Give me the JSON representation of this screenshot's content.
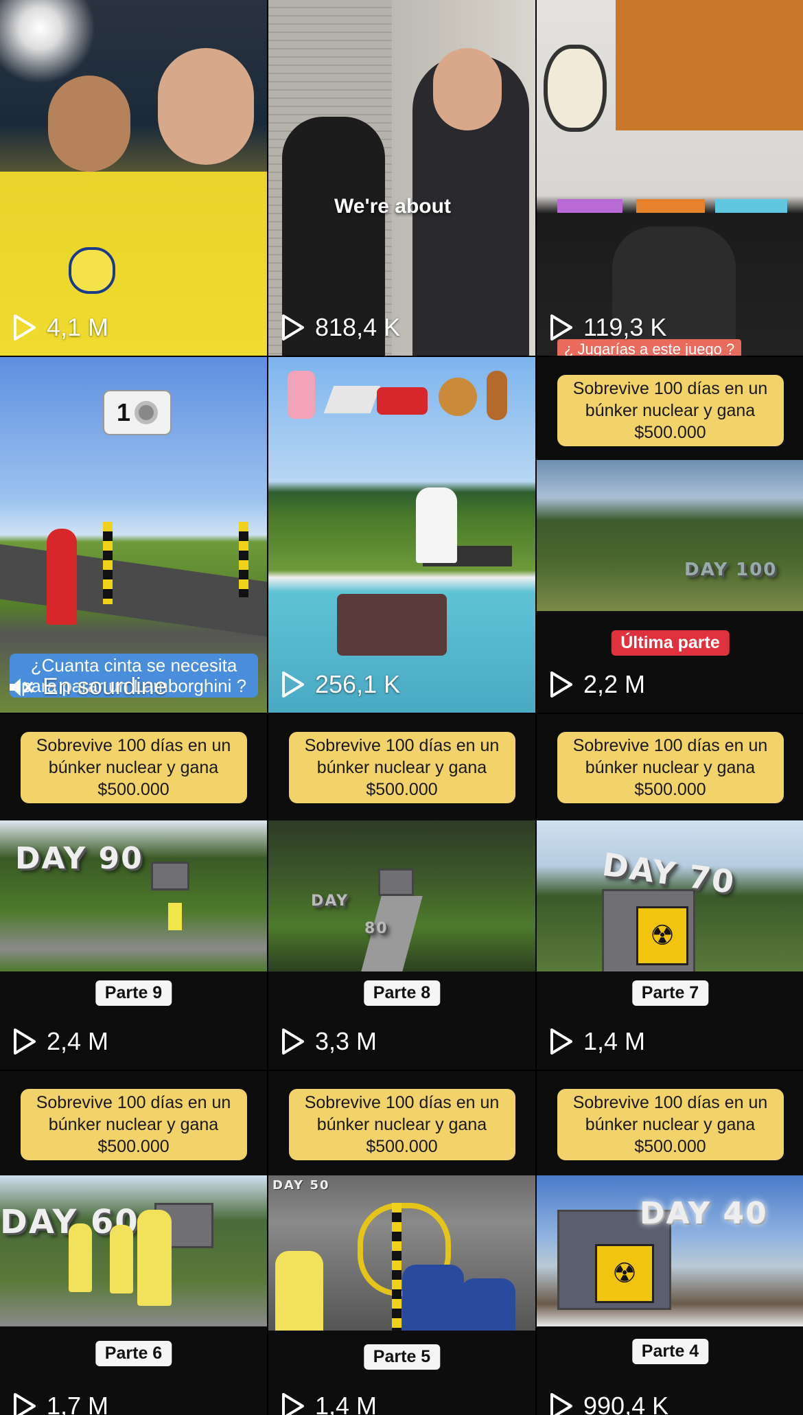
{
  "grid": {
    "tiles": [
      {
        "views": "4,1 M"
      },
      {
        "views": "818,4 K",
        "overlay": "We're about"
      },
      {
        "views": "119,3 K",
        "caption": "¿ Jugarías a este juego ?"
      },
      {
        "badge": "1",
        "caption": "¿Cuanta cinta se necesita para parar un Lamborghini ?",
        "muted": "En sourdine"
      },
      {
        "views": "256,1 K"
      },
      {
        "views": "2,2 M",
        "promo": "Sobrevive 100 días en un búnker nuclear y gana $500.000",
        "day": "DAY 100",
        "part": "Última parte"
      },
      {
        "views": "2,4 M",
        "promo": "Sobrevive 100 días en un búnker nuclear y gana $500.000",
        "day": "DAY 90",
        "part": "Parte 9"
      },
      {
        "views": "3,3 M",
        "promo": "Sobrevive 100 días en un búnker nuclear y gana $500.000",
        "day": "DAY",
        "day2": "80",
        "part": "Parte 8"
      },
      {
        "views": "1,4 M",
        "promo": "Sobrevive 100 días en un búnker nuclear y gana $500.000",
        "day": "DAY 70",
        "part": "Parte 7"
      },
      {
        "views": "1,7 M",
        "promo": "Sobrevive 100 días en un búnker nuclear y gana $500.000",
        "day": "DAY 60",
        "part": "Parte 6"
      },
      {
        "views": "1,4 M",
        "promo": "Sobrevive 100 días en un búnker nuclear y gana $500.000",
        "day": "DAY 50",
        "part": "Parte 5"
      },
      {
        "views": "990,4 K",
        "promo": "Sobrevive 100 días en un búnker nuclear y gana $500.000",
        "day": "DAY 40",
        "part": "Parte 4"
      }
    ]
  },
  "icons": {
    "play": "play-outline-icon",
    "mute": "speaker-muted-icon"
  },
  "colors": {
    "promo_bg": "#f2d36b",
    "last_part_bg": "#e0313e",
    "background": "#000000"
  }
}
